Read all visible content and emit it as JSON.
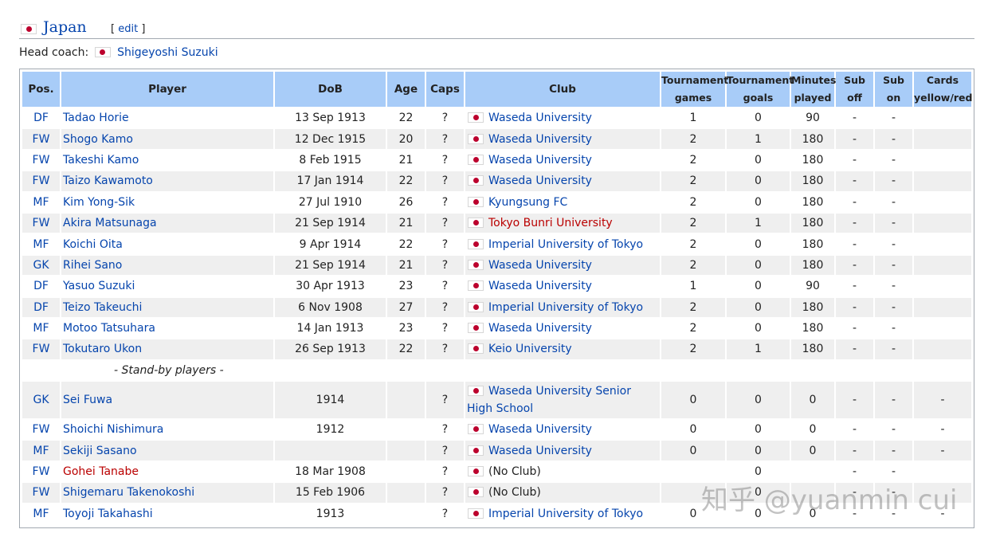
{
  "section": {
    "title": "Japan",
    "edit_open": "[ ",
    "edit_label": "edit",
    "edit_close": " ]"
  },
  "coach": {
    "label": "Head coach:",
    "name": "Shigeyoshi Suzuki"
  },
  "columns": [
    "Pos.",
    "Player",
    "DoB",
    "Age",
    "Caps",
    "Club",
    "Tournament",
    "games",
    "Tournament",
    "goals",
    "Minutes",
    "played",
    "Sub",
    "off",
    "Sub",
    "on",
    "Cards",
    "yellow/red"
  ],
  "players": [
    {
      "pos": "DF",
      "name": "Tadao Horie",
      "dob": "13 Sep 1913",
      "age": "22",
      "caps": "?",
      "club": "Waseda University",
      "games": "1",
      "goals": "0",
      "minutes": "90",
      "sub_off": "-",
      "sub_on": "-",
      "cards": ""
    },
    {
      "pos": "FW",
      "name": "Shogo Kamo",
      "dob": "12 Dec 1915",
      "age": "20",
      "caps": "?",
      "club": "Waseda University",
      "games": "2",
      "goals": "1",
      "minutes": "180",
      "sub_off": "-",
      "sub_on": "-",
      "cards": ""
    },
    {
      "pos": "FW",
      "name": "Takeshi Kamo",
      "dob": "8 Feb 1915",
      "age": "21",
      "caps": "?",
      "club": "Waseda University",
      "games": "2",
      "goals": "0",
      "minutes": "180",
      "sub_off": "-",
      "sub_on": "-",
      "cards": ""
    },
    {
      "pos": "FW",
      "name": "Taizo Kawamoto",
      "dob": "17 Jan 1914",
      "age": "22",
      "caps": "?",
      "club": "Waseda University",
      "games": "2",
      "goals": "0",
      "minutes": "180",
      "sub_off": "-",
      "sub_on": "-",
      "cards": ""
    },
    {
      "pos": "MF",
      "name": "Kim Yong-Sik",
      "dob": "27 Jul 1910",
      "age": "26",
      "caps": "?",
      "club": "Kyungsung FC",
      "games": "2",
      "goals": "0",
      "minutes": "180",
      "sub_off": "-",
      "sub_on": "-",
      "cards": ""
    },
    {
      "pos": "FW",
      "name": "Akira Matsunaga",
      "dob": "21 Sep 1914",
      "age": "21",
      "caps": "?",
      "club": "Tokyo Bunri University",
      "club_red": true,
      "games": "2",
      "goals": "1",
      "minutes": "180",
      "sub_off": "-",
      "sub_on": "-",
      "cards": ""
    },
    {
      "pos": "MF",
      "name": "Koichi Oita",
      "dob": "9 Apr 1914",
      "age": "22",
      "caps": "?",
      "club": "Imperial University of Tokyo",
      "games": "2",
      "goals": "0",
      "minutes": "180",
      "sub_off": "-",
      "sub_on": "-",
      "cards": ""
    },
    {
      "pos": "GK",
      "name": "Rihei Sano",
      "dob": "21 Sep 1914",
      "age": "21",
      "caps": "?",
      "club": "Waseda University",
      "games": "2",
      "goals": "0",
      "minutes": "180",
      "sub_off": "-",
      "sub_on": "-",
      "cards": ""
    },
    {
      "pos": "DF",
      "name": "Yasuo Suzuki",
      "dob": "30 Apr 1913",
      "age": "23",
      "caps": "?",
      "club": "Waseda University",
      "games": "1",
      "goals": "0",
      "minutes": "90",
      "sub_off": "-",
      "sub_on": "-",
      "cards": ""
    },
    {
      "pos": "DF",
      "name": "Teizo Takeuchi",
      "dob": "6 Nov 1908",
      "age": "27",
      "caps": "?",
      "club": "Imperial University of Tokyo",
      "games": "2",
      "goals": "0",
      "minutes": "180",
      "sub_off": "-",
      "sub_on": "-",
      "cards": ""
    },
    {
      "pos": "MF",
      "name": "Motoo Tatsuhara",
      "dob": "14 Jan 1913",
      "age": "23",
      "caps": "?",
      "club": "Waseda University",
      "games": "2",
      "goals": "0",
      "minutes": "180",
      "sub_off": "-",
      "sub_on": "-",
      "cards": ""
    },
    {
      "pos": "FW",
      "name": "Tokutaro Ukon",
      "dob": "26 Sep 1913",
      "age": "22",
      "caps": "?",
      "club": "Keio University",
      "games": "2",
      "goals": "1",
      "minutes": "180",
      "sub_off": "-",
      "sub_on": "-",
      "cards": ""
    }
  ],
  "standby_label": "- Stand-by players -",
  "standby": [
    {
      "pos": "GK",
      "name": "Sei Fuwa",
      "dob": "1914",
      "age": "",
      "caps": "?",
      "club": "Waseda University Senior High School",
      "games": "0",
      "goals": "0",
      "minutes": "0",
      "sub_off": "-",
      "sub_on": "-",
      "cards": "-"
    },
    {
      "pos": "FW",
      "name": "Shoichi Nishimura",
      "dob": "1912",
      "age": "",
      "caps": "?",
      "club": "Waseda University",
      "games": "0",
      "goals": "0",
      "minutes": "0",
      "sub_off": "-",
      "sub_on": "-",
      "cards": "-"
    },
    {
      "pos": "MF",
      "name": "Sekiji Sasano",
      "dob": "",
      "age": "",
      "caps": "?",
      "club": "Waseda University",
      "games": "0",
      "goals": "0",
      "minutes": "0",
      "sub_off": "-",
      "sub_on": "-",
      "cards": "-"
    },
    {
      "pos": "FW",
      "name": "Gohei Tanabe",
      "name_red": true,
      "dob": "18 Mar 1908",
      "age": "",
      "caps": "?",
      "club": "(No Club)",
      "club_plain": true,
      "games": "",
      "goals": "0",
      "minutes": "",
      "sub_off": "-",
      "sub_on": "-",
      "cards": ""
    },
    {
      "pos": "FW",
      "name": "Shigemaru Takenokoshi",
      "dob": "15 Feb 1906",
      "age": "",
      "caps": "?",
      "club": "(No Club)",
      "club_plain": true,
      "games": "",
      "goals": "0",
      "minutes": "",
      "sub_off": "-",
      "sub_on": "-",
      "cards": ""
    },
    {
      "pos": "MF",
      "name": "Toyoji Takahashi",
      "dob": "1913",
      "age": "",
      "caps": "?",
      "club": "Imperial University of Tokyo",
      "games": "0",
      "goals": "0",
      "minutes": "0",
      "sub_off": "-",
      "sub_on": "-",
      "cards": "-"
    }
  ],
  "watermark": "知乎 @yuanmin cui",
  "colors": {
    "header_bg": "#a8ccf8",
    "link": "#0645ad",
    "redlink": "#ba0000",
    "row_alt": "#efefef",
    "flag_red": "#bc002d"
  }
}
